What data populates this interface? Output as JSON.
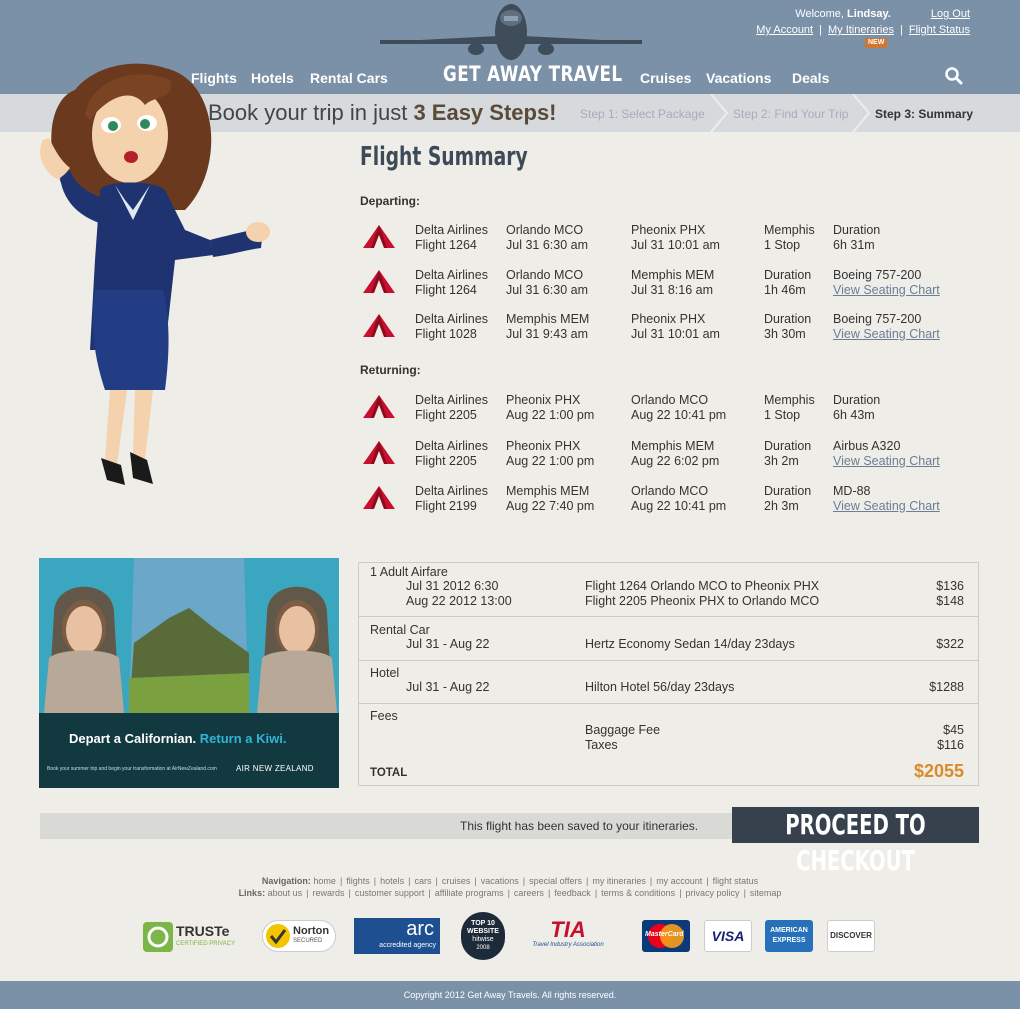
{
  "header": {
    "welcome_prefix": "Welcome, ",
    "user_name": "Lindsay.",
    "logout": "Log Out",
    "my_account": "My Account",
    "my_itineraries": "My Itineraries",
    "flight_status": "Flight Status",
    "new_badge": "NEW",
    "brand": "GET AWAY TRAVEL",
    "nav_left": [
      "Flights",
      "Hotels",
      "Rental Cars"
    ],
    "nav_right": [
      "Cruises",
      "Vacations",
      "Deals"
    ],
    "sep": "|"
  },
  "steps": {
    "book_prefix": "Book your trip in just ",
    "book_bold": "3 Easy Steps!",
    "step1": "Step 1: Select Package",
    "step2": "Step 2: Find Your Trip",
    "step3": "Step 3: Summary"
  },
  "flight_summary": {
    "title": "Flight Summary",
    "departing_label": "Departing:",
    "returning_label": "Returning:",
    "departing": [
      {
        "airline": "Delta Airlines",
        "flight": "Flight 1264",
        "from": "Orlando MCO",
        "from_time": "Jul 31 6:30 am",
        "to": "Pheonix PHX",
        "to_time": "Jul 31 10:01 am",
        "c4a": "Memphis",
        "c4b": "1 Stop",
        "c5a": "Duration",
        "c5b": "6h 31m",
        "c5b_link": false
      },
      {
        "airline": "Delta Airlines",
        "flight": "Flight 1264",
        "from": "Orlando MCO",
        "from_time": "Jul 31 6:30 am",
        "to": "Memphis MEM",
        "to_time": "Jul 31 8:16 am",
        "c4a": "Duration",
        "c4b": "1h 46m",
        "c5a": "Boeing 757-200",
        "c5b": "View Seating Chart",
        "c5b_link": true
      },
      {
        "airline": "Delta Airlines",
        "flight": "Flight 1028",
        "from": "Memphis MEM",
        "from_time": "Jul 31 9:43 am",
        "to": "Pheonix PHX",
        "to_time": "Jul 31 10:01 am",
        "c4a": "Duration",
        "c4b": "3h 30m",
        "c5a": "Boeing 757-200",
        "c5b": "View Seating Chart",
        "c5b_link": true
      }
    ],
    "returning": [
      {
        "airline": "Delta Airlines",
        "flight": "Flight 2205",
        "from": "Pheonix PHX",
        "from_time": "Aug 22 1:00 pm",
        "to": "Orlando MCO",
        "to_time": "Aug 22 10:41 pm",
        "c4a": "Memphis",
        "c4b": "1 Stop",
        "c5a": "Duration",
        "c5b": "6h 43m",
        "c5b_link": false
      },
      {
        "airline": "Delta Airlines",
        "flight": "Flight 2205",
        "from": "Pheonix PHX",
        "from_time": "Aug 22 1:00 pm",
        "to": "Memphis MEM",
        "to_time": "Aug 22 6:02 pm",
        "c4a": "Duration",
        "c4b": "3h 2m",
        "c5a": "Airbus A320",
        "c5b": "View Seating Chart",
        "c5b_link": true
      },
      {
        "airline": "Delta Airlines",
        "flight": "Flight 2199",
        "from": "Memphis MEM",
        "from_time": "Aug 22 7:40 pm",
        "to": "Orlando MCO",
        "to_time": "Aug 22 10:41 pm",
        "c4a": "Duration",
        "c4b": "2h 3m",
        "c5a": "MD-88",
        "c5b": "View Seating Chart",
        "c5b_link": true
      }
    ]
  },
  "ad": {
    "headline": "Depart a Californian.",
    "headline_accent": "Return a Kiwi.",
    "fine_print": "Book your summer trip and begin your transformation at AirNewZealand.com",
    "brand": "AIR NEW ZEALAND"
  },
  "summary": {
    "airfare_label": "1 Adult Airfare",
    "airfare_rows": [
      {
        "date": "Jul 31 2012 6:30",
        "desc": "Flight 1264 Orlando MCO to Pheonix PHX",
        "amount": "$136"
      },
      {
        "date": "Aug 22 2012 13:00",
        "desc": "Flight 2205 Pheonix PHX to Orlando MCO",
        "amount": "$148"
      }
    ],
    "car_label": "Rental Car",
    "car_dates": "Jul 31 - Aug 22",
    "car_desc": "Hertz Economy Sedan 14/day 23days",
    "car_amount": "$322",
    "hotel_label": "Hotel",
    "hotel_dates": "Jul 31 - Aug 22",
    "hotel_desc": "Hilton Hotel 56/day 23days",
    "hotel_amount": "$1288",
    "fees_label": "Fees",
    "baggage_label": "Baggage Fee",
    "baggage_amount": "$45",
    "taxes_label": "Taxes",
    "taxes_amount": "$116",
    "total_label": "TOTAL",
    "total_amount": "$2055"
  },
  "checkout": {
    "saved_message": "This flight has been saved to your itineraries.",
    "button": "PROCEED TO CHECKOUT"
  },
  "footer": {
    "nav_label": "Navigation:",
    "nav_links": [
      "home",
      "flights",
      "hotels",
      "cars",
      "cruises",
      "vacations",
      "special offers",
      "my itineraries",
      "my account",
      "flight status"
    ],
    "links_label": "Links:",
    "links": [
      "about us",
      "rewards",
      "customer support",
      "affiliate programs",
      "careers",
      "feedback",
      "terms & conditions",
      "privacy policy",
      "sitemap"
    ],
    "copyright": "Copyright 2012 Get Away Travels. All rights reserved.",
    "sep": "|"
  },
  "badges": {
    "truste": "TRUSTe",
    "truste_sub": "CERTIFIED PRIVACY",
    "norton": "Norton",
    "norton_sub": "SECURED",
    "arc": "arc",
    "arc_sub": "accredited agency",
    "top10_a": "TOP 10",
    "top10_b": "WEBSITE",
    "top10_c": "hitwise",
    "top10_d": "2008",
    "tia": "TIA",
    "tia_sub": "Travel Industry Association",
    "mastercard": "MasterCard",
    "visa": "VISA",
    "amex_a": "AMERICAN",
    "amex_b": "EXPRESS",
    "discover": "DISCOVER"
  },
  "colors": {
    "header_bg": "#7b91a8",
    "page_bg": "#efede7",
    "total_orange": "#d98a2b",
    "delta_red": "#c8102e",
    "checkout_bg": "#36414d"
  }
}
